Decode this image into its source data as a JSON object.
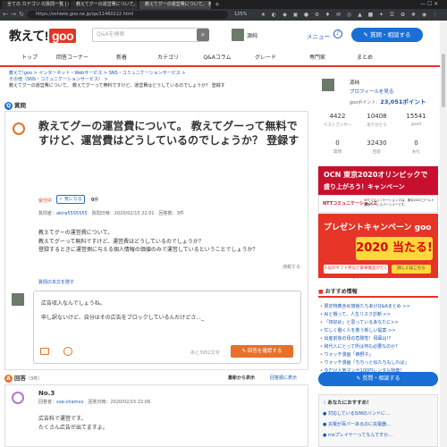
{
  "browser": {
    "tabs": [
      "全ての カテゴリ の質問一覧 | 教えて!goo",
      "教えてグーの運営費について。 教えてグーって…",
      "教えてグーの運営費について。 教えてグ..."
    ],
    "url": "https://oshiete.goo.ne.jp/qa/11460222.html",
    "zoom": "125%"
  },
  "header": {
    "logo_text": "教えて!",
    "logo_goo": "goo",
    "search_placeholder": "Q&Aを検索",
    "username": "源純",
    "menu_label": "メニュー",
    "ask_button": "質問・相談する"
  },
  "nav": [
    "トップ",
    "回答コーナー",
    "新着",
    "カテゴリ",
    "Q&Aコラム",
    "グレード",
    "専門家",
    "まとめ"
  ],
  "breadcrumb": {
    "line1": [
      "教えて!goo",
      "インターネット・Webサービス",
      "SNS・コミュニケーションサービス"
    ],
    "line2": "その他（SNS・コミュニケーションサービス）",
    "current": "教えてグーの運営費について。 教えてグーって無料ですけど、運営費はどうしているのでしょうか？ 登録す"
  },
  "question": {
    "section_label": "質問",
    "title": "教えてグーの運営費について。 教えてグーって無料ですけど、運営費はどうしているのでしょうか？ 登録す",
    "status": "受付中",
    "kininaru_label": "気になる",
    "kininaru_count": "0",
    "count_unit": "件",
    "meta_prefix": "質問者：",
    "meta_user": "akira5555555",
    "meta_rest": "質問日時：2020/02/15 22:01　回答数：3件",
    "body": [
      "教えてグーの運営費について。",
      "教えてグーって無料ですけど、運営費はどうしているのでしょうか？",
      "登録するときに運営側に与える個人情報の価値のみで運営しているということでしょうか？"
    ],
    "report_label": "通報する",
    "hide_label": "質問の本文を隠す"
  },
  "comment": {
    "text": [
      "広告収入なんでしょうね。",
      "申し訳ないけど、自分はその広告をブロックしているんだけどさ..._"
    ],
    "remaining": "あと3952文字",
    "submit_label": "回答を確認する"
  },
  "answers_header": {
    "label": "回答",
    "count": "（3件）",
    "sort_new": "最新から表示",
    "sort_old": "回答順に表示"
  },
  "answer": {
    "number": "No.3",
    "meta_prefix": "回答者：",
    "meta_user": "xxe-chamxx",
    "meta_rest": "回答日時：2020/02/15 22:06",
    "body": [
      "広告料で運営です。",
      "たくさん広告が出てますよ。"
    ]
  },
  "sidebar": {
    "username": "源純",
    "profile_link": "プロフィールを見る",
    "points_prefix": "gooポイント：",
    "points_value": "23,051ポイント",
    "stats": [
      {
        "value": "4422",
        "label": "ベストアンサー"
      },
      {
        "value": "10408",
        "label": "ありがとう"
      },
      {
        "value": "15541",
        "label": "good"
      },
      {
        "value": "0",
        "label": "質問"
      },
      {
        "value": "32430",
        "label": "回答"
      },
      {
        "value": "0",
        "label": "お礼"
      }
    ],
    "ad1_line1": "OCN 東京2020オリンピックで",
    "ad1_line2": "盛り上がろう！キャンペーン",
    "ad1_brand": "NTTコミュニケーションズ",
    "ad1_note": "NTTコミュニケーションズは、東京2020ゴールド通信サービスパートナーです。",
    "ad2_line1": "プレゼントキャンペーン goo",
    "ad2_big": "2020 当たる!",
    "ad2_note": "人気のギフト券など豪華賞品がたくさん",
    "ad2_button": "詳しくはこちら",
    "recommend_title": "おすすめ情報",
    "recommend_items": [
      "限定特典含め旅館たちあげQ&Aまとめ >>",
      "AIと戦って、人生リスク診断 >>",
      "「将好め」と思っているあなたに>>",
      "忙しく働く人を救う新しい提案 >>",
      "出産前後の母の危険性！母図は!?",
      "和代人にとって所は何も必要なのか？",
      "ウォッチ漫画「西野子」",
      "ウォッチ漫画「ちちっと似たちもしれば」",
      "今だけ人気マンガ100円レンタル特典！"
    ],
    "ask_button": "質問・相談する",
    "rec2_title": "あなたにおすすめ！",
    "rec2_items": [
      "対応しているSIMのバンドに…",
      "充電が百パーあるのに充電器…",
      "mxプレイヤーってなんですか…"
    ]
  }
}
